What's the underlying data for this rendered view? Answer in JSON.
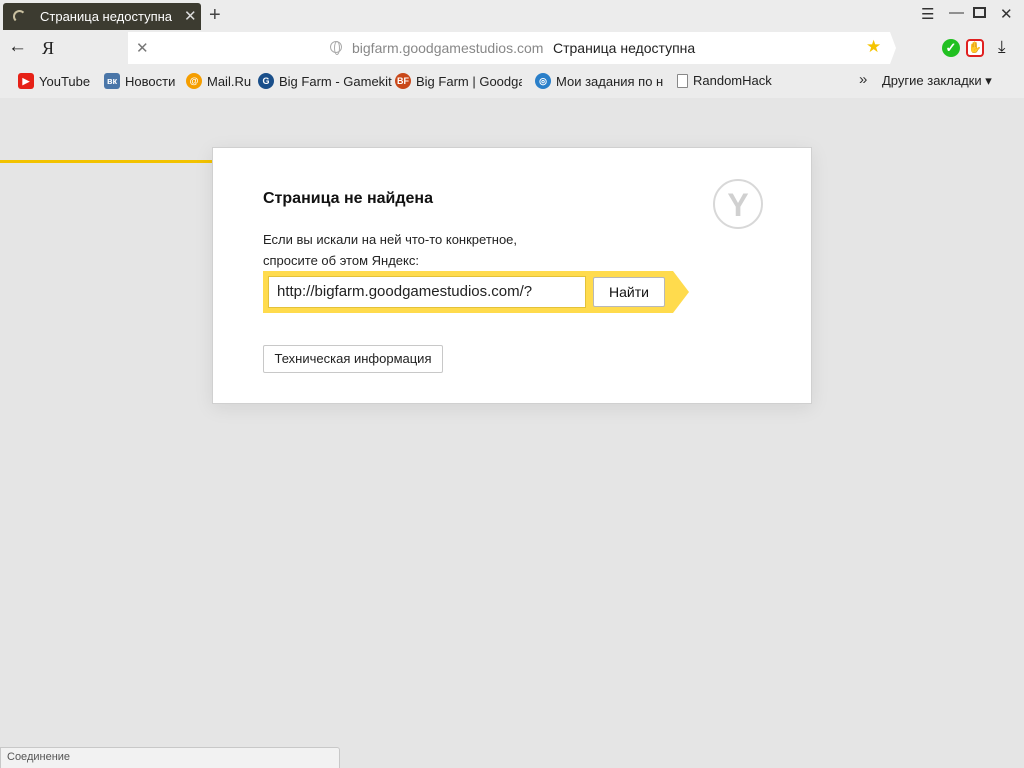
{
  "tab": {
    "title": "Страница недоступна"
  },
  "window_controls": [
    "menu-icon",
    "minimize-icon",
    "restore-icon",
    "close-icon"
  ],
  "nav": {
    "ya_label": "Я"
  },
  "omnibox": {
    "host": "bigfarm.goodgamestudios.com",
    "title": "Страница недоступна"
  },
  "bookmarks": {
    "items": [
      {
        "label": "YouTube",
        "icon": "youtube-icon",
        "color": "#e62117"
      },
      {
        "label": "Новости",
        "icon": "vk-icon",
        "color": "#4a76a8"
      },
      {
        "label": "Mail.Ru",
        "icon": "mailru-icon",
        "color": "#f59e00"
      },
      {
        "label": "Big Farm - Gamekit",
        "icon": "gamekit-icon",
        "color": "#1a4f8a"
      },
      {
        "label": "Big Farm | Goodgar",
        "icon": "bigfarm-icon",
        "color": "#c9481a"
      },
      {
        "label": "Мои задания по на",
        "icon": "target-icon",
        "color": "#2a7fc9"
      },
      {
        "label": "RandomHack",
        "icon": "page-icon",
        "color": "#ffffff"
      }
    ],
    "more": "»",
    "other_label": "Другие закладки ▾"
  },
  "error": {
    "heading": "Страница не найдена",
    "line1": "Если вы искали на ней что-то конкретное,",
    "line2": "спросите об этом Яндекс:",
    "query_value": "http://bigfarm.goodgamestudios.com/?",
    "search_button": "Найти",
    "tech_button": "Техническая информация",
    "logo_letter": "Y",
    "accent_color": "#ffdb4d"
  },
  "status_text": "Соединение"
}
